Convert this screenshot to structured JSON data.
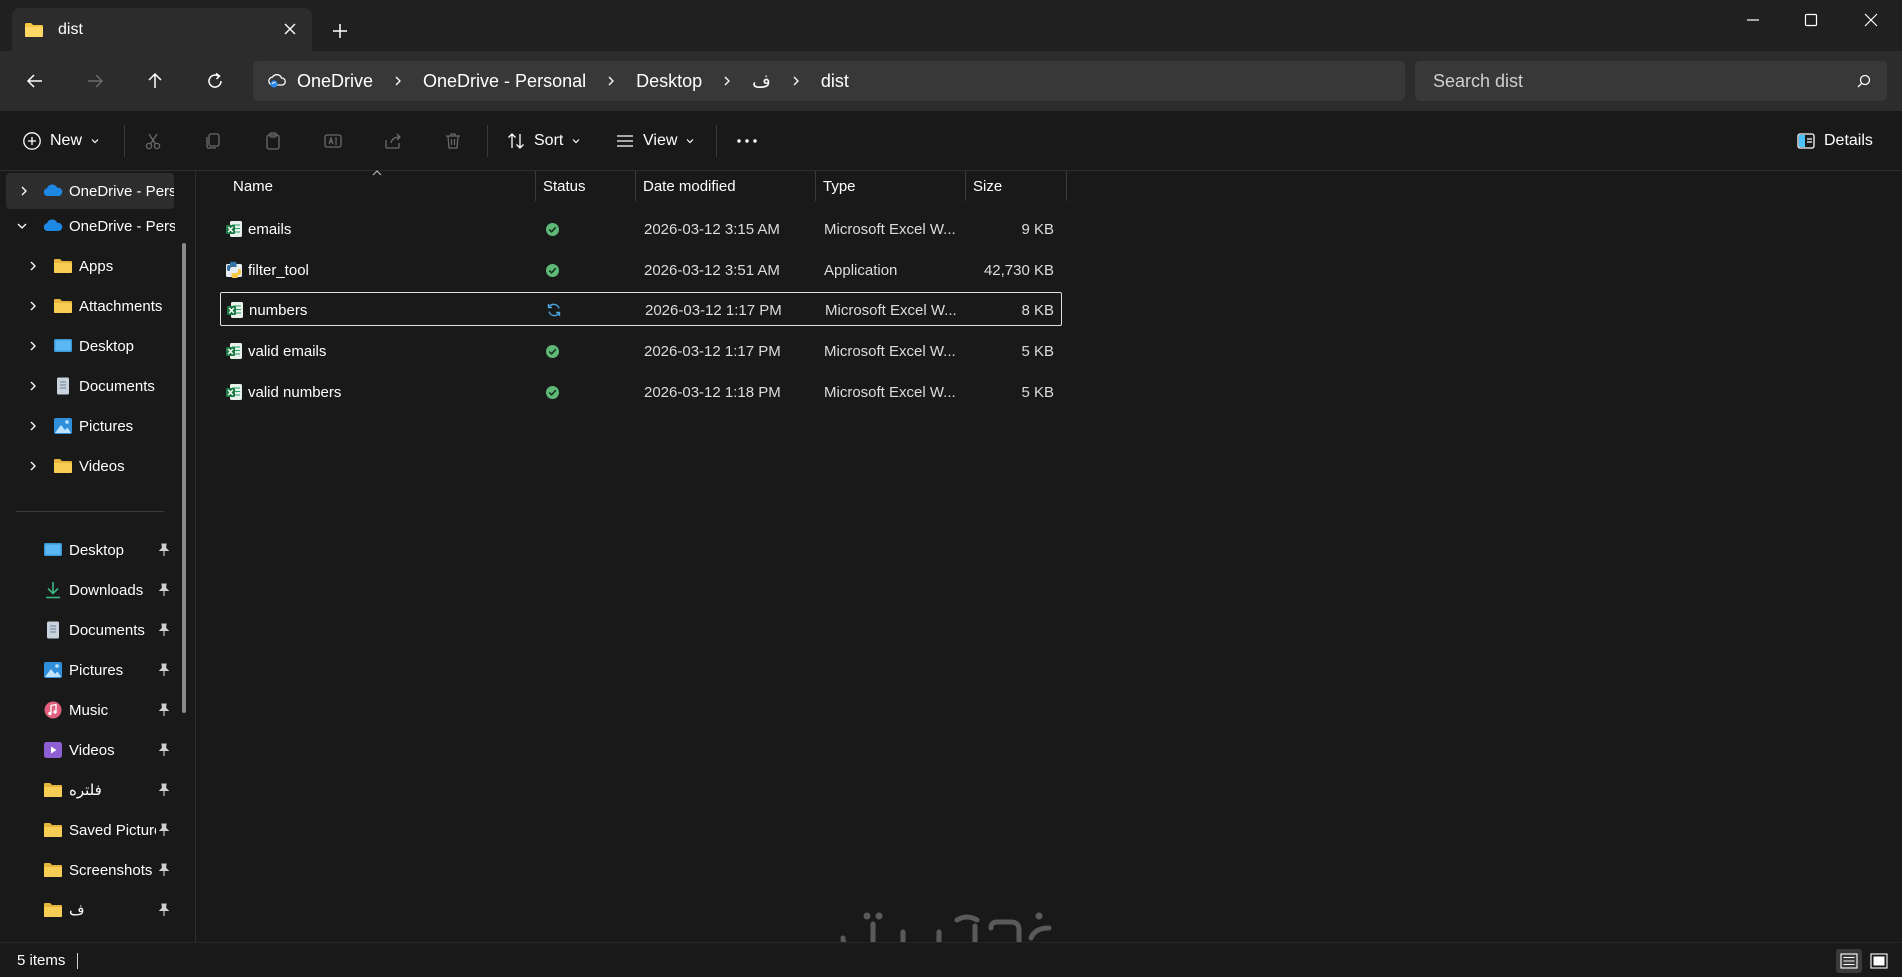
{
  "window": {
    "tab_title": "dist",
    "new_tab_symbol": "+"
  },
  "address": {
    "breadcrumbs": [
      "OneDrive",
      "OneDrive - Personal",
      "Desktop",
      "ف",
      "dist"
    ],
    "search_placeholder": "Search dist"
  },
  "toolbar": {
    "new_label": "New",
    "sort_label": "Sort",
    "view_label": "View",
    "details_label": "Details"
  },
  "sidebar": {
    "tree": [
      {
        "label": "OneDrive - Perso",
        "icon": "onedrive-cloud-icon",
        "expanded": false,
        "selected": true
      },
      {
        "label": "OneDrive - Perso",
        "icon": "onedrive-cloud-icon",
        "expanded": true,
        "selected": false
      },
      {
        "label": "Apps",
        "icon": "folder-icon"
      },
      {
        "label": "Attachments",
        "icon": "folder-icon"
      },
      {
        "label": "Desktop",
        "icon": "desktop-icon"
      },
      {
        "label": "Documents",
        "icon": "documents-icon"
      },
      {
        "label": "Pictures",
        "icon": "pictures-icon"
      },
      {
        "label": "Videos",
        "icon": "folder-icon"
      }
    ],
    "quick_access": [
      {
        "label": "Desktop",
        "icon": "desktop-icon"
      },
      {
        "label": "Downloads",
        "icon": "download-icon"
      },
      {
        "label": "Documents",
        "icon": "documents-icon"
      },
      {
        "label": "Pictures",
        "icon": "pictures-icon"
      },
      {
        "label": "Music",
        "icon": "music-icon"
      },
      {
        "label": "Videos",
        "icon": "videos-icon"
      },
      {
        "label": "فلتره",
        "icon": "folder-icon"
      },
      {
        "label": "Saved Pictures",
        "icon": "folder-icon"
      },
      {
        "label": "Screenshots",
        "icon": "folder-icon"
      },
      {
        "label": "ف",
        "icon": "folder-icon"
      }
    ]
  },
  "files": {
    "columns": [
      "Name",
      "Status",
      "Date modified",
      "Type",
      "Size"
    ],
    "rows": [
      {
        "name": "emails",
        "status": "synced",
        "date": "2026-03-12 3:15 AM",
        "type": "Microsoft Excel W...",
        "size": "9 KB",
        "icon": "excel-file-icon"
      },
      {
        "name": "filter_tool",
        "status": "synced",
        "date": "2026-03-12 3:51 AM",
        "type": "Application",
        "size": "42,730 KB",
        "icon": "python-app-icon"
      },
      {
        "name": "numbers",
        "status": "syncing",
        "date": "2026-03-12 1:17 PM",
        "type": "Microsoft Excel W...",
        "size": "8 KB",
        "icon": "excel-file-icon",
        "focused": true
      },
      {
        "name": "valid emails",
        "status": "synced",
        "date": "2026-03-12 1:17 PM",
        "type": "Microsoft Excel W...",
        "size": "5 KB",
        "icon": "excel-file-icon"
      },
      {
        "name": "valid numbers",
        "status": "synced",
        "date": "2026-03-12 1:18 PM",
        "type": "Microsoft Excel W...",
        "size": "5 KB",
        "icon": "excel-file-icon"
      }
    ]
  },
  "statusbar": {
    "item_count": "5 items"
  },
  "watermark": {
    "text": "خمسات"
  },
  "colors": {
    "accent_blue": "#4cc2ff",
    "folder_yellow": "#f6c544",
    "excel_green": "#1d7a45",
    "sync_ok_green": "#5fb878"
  }
}
